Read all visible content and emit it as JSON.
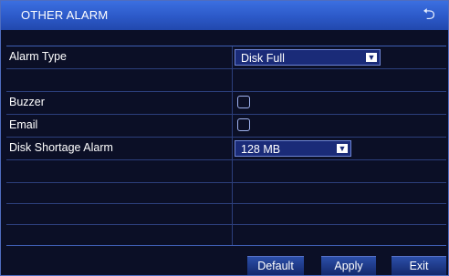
{
  "title": "OTHER ALARM",
  "back_icon": "return-arrow-icon",
  "rows": {
    "alarm_type": {
      "label": "Alarm Type",
      "value": "Disk Full"
    },
    "buzzer": {
      "label": "Buzzer",
      "checked": false
    },
    "email": {
      "label": "Email",
      "checked": false
    },
    "disk_shortage": {
      "label": "Disk Shortage Alarm",
      "value": "128 MB"
    }
  },
  "buttons": {
    "default": "Default",
    "apply": "Apply",
    "exit": "Exit"
  },
  "colors": {
    "title_bar": "#2c59c8",
    "background": "#0b0f26",
    "grid_line": "#2c3f7c",
    "select_bg": "#1a2b78"
  }
}
